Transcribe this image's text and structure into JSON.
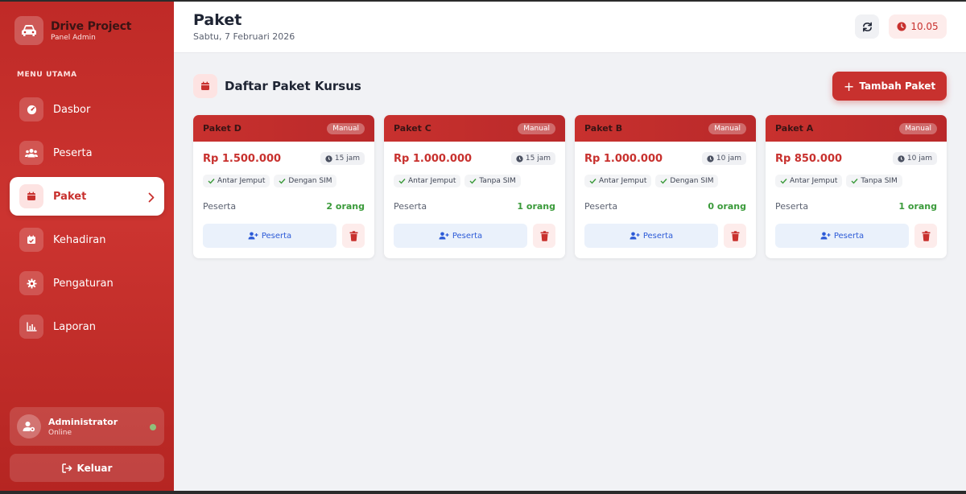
{
  "brand": {
    "title": "Drive Project",
    "subtitle": "Panel Admin"
  },
  "sidebar": {
    "menu_label": "MENU UTAMA",
    "items": [
      {
        "label": "Dasbor",
        "icon": "gauge-icon"
      },
      {
        "label": "Peserta",
        "icon": "users-icon"
      },
      {
        "label": "Paket",
        "icon": "calendar-icon",
        "active": true
      },
      {
        "label": "Kehadiran",
        "icon": "calendar-check-icon"
      },
      {
        "label": "Pengaturan",
        "icon": "gear-icon"
      },
      {
        "label": "Laporan",
        "icon": "chart-icon"
      }
    ],
    "user": {
      "name": "Administrator",
      "status": "Online"
    },
    "logout_label": "Keluar"
  },
  "header": {
    "title": "Paket",
    "date": "Sabtu, 7 Februari 2026",
    "time": "10.05"
  },
  "section": {
    "title": "Daftar Paket Kursus",
    "add_label": "Tambah Paket"
  },
  "cards": [
    {
      "name": "Paket D",
      "tag": "Manual",
      "price": "Rp 1.500.000",
      "hours": "15 jam",
      "features": [
        "Antar Jemput",
        "Dengan SIM"
      ],
      "peserta_label": "Peserta",
      "peserta_count": "2 orang",
      "button_label": "Peserta"
    },
    {
      "name": "Paket C",
      "tag": "Manual",
      "price": "Rp 1.000.000",
      "hours": "15 jam",
      "features": [
        "Antar Jemput",
        "Tanpa SIM"
      ],
      "peserta_label": "Peserta",
      "peserta_count": "1 orang",
      "button_label": "Peserta"
    },
    {
      "name": "Paket B",
      "tag": "Manual",
      "price": "Rp 1.000.000",
      "hours": "10 jam",
      "features": [
        "Antar Jemput",
        "Dengan SIM"
      ],
      "peserta_label": "Peserta",
      "peserta_count": "0 orang",
      "button_label": "Peserta"
    },
    {
      "name": "Paket A",
      "tag": "Manual",
      "price": "Rp 850.000",
      "hours": "10 jam",
      "features": [
        "Antar Jemput",
        "Tanpa SIM"
      ],
      "peserta_label": "Peserta",
      "peserta_count": "1 orang",
      "button_label": "Peserta"
    }
  ],
  "colors": {
    "primary": "#c8312e",
    "success": "#3a9a3a",
    "link": "#2d5bd7"
  }
}
